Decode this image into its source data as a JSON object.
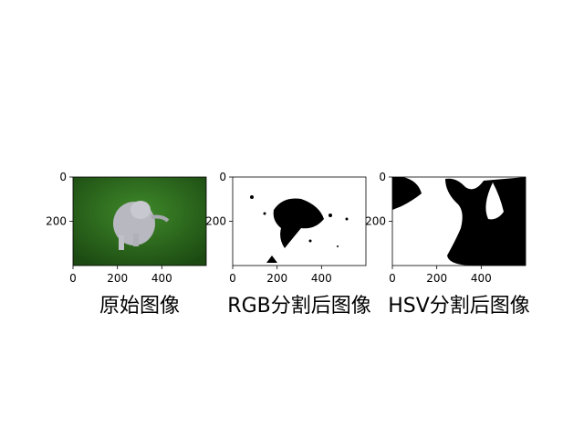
{
  "chart_data": [
    {
      "type": "image",
      "title": "原始图像",
      "image_size": [
        600,
        400
      ],
      "xticks": [
        "0",
        "200",
        "400"
      ],
      "yticks": [
        "0",
        "200"
      ],
      "content": "cat-on-grass-photo"
    },
    {
      "type": "image",
      "title": "RGB分割后图像",
      "image_size": [
        600,
        400
      ],
      "xticks": [
        "0",
        "200",
        "400"
      ],
      "yticks": [
        "0",
        "200"
      ],
      "content": "binary-mask-rgb"
    },
    {
      "type": "image",
      "title": "HSV分割后图像",
      "image_size": [
        600,
        400
      ],
      "xticks": [
        "0",
        "200",
        "400"
      ],
      "yticks": [
        "0",
        "200"
      ],
      "content": "binary-mask-hsv"
    }
  ]
}
